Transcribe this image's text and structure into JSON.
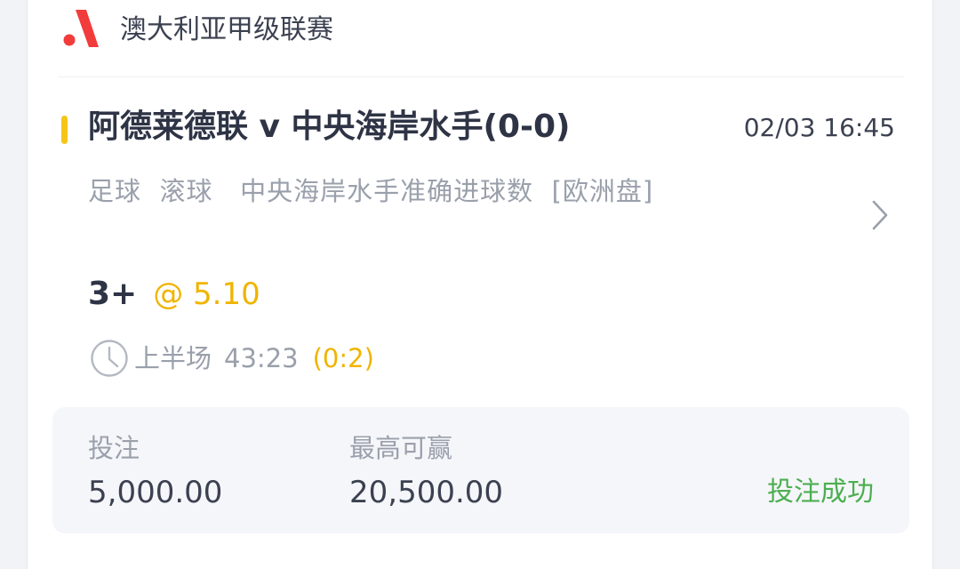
{
  "header": {
    "league": "澳大利亚甲级联赛",
    "logo_icon": "brand-logo-icon",
    "brand_color": "#f23c3c"
  },
  "match": {
    "title": "阿德莱德联 v 中央海岸水手(0-0)",
    "datetime": "02/03 16:45",
    "sport": "足球",
    "bet_type": "滚球",
    "market": "中央海岸水手准确进球数",
    "odds_format": "[欧洲盘]",
    "accent_color": "#f5c518"
  },
  "selection": {
    "pick": "3+",
    "odds": "@ 5.10"
  },
  "live": {
    "period": "上半场",
    "clock": "43:23",
    "score": "(0:2)"
  },
  "summary": {
    "stake_label": "投注",
    "stake_value": "5,000.00",
    "payout_label": "最高可赢",
    "payout_value": "20,500.00",
    "status": "投注成功",
    "status_color": "#4caf50"
  }
}
